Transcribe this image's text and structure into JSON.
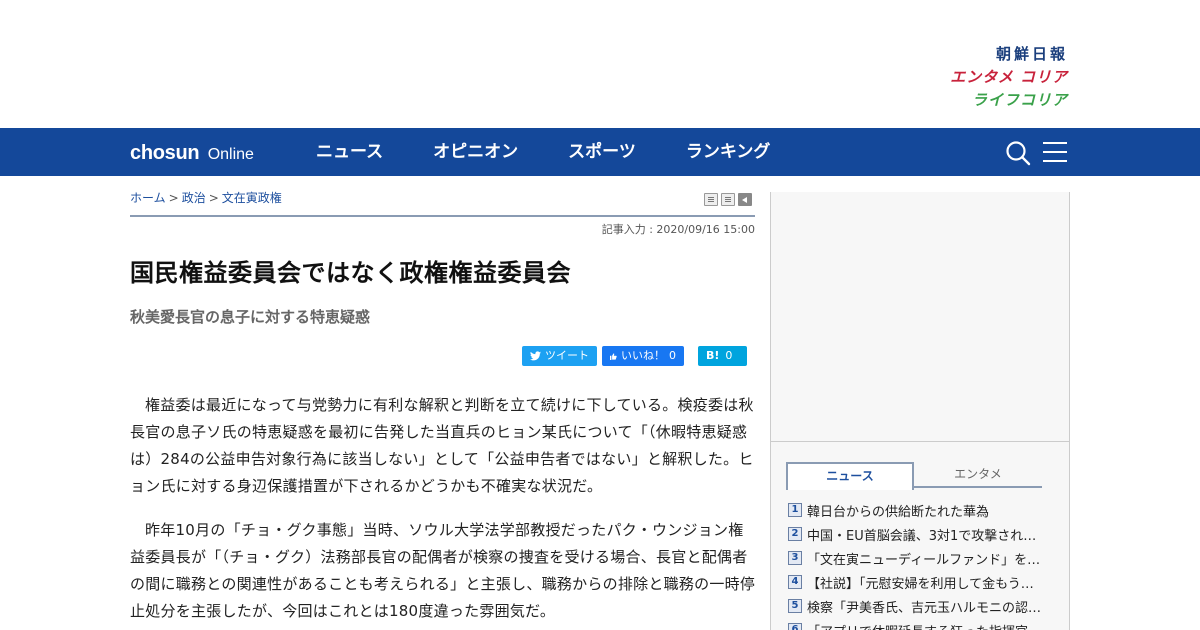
{
  "brands": {
    "chosun": "朝鮮日報",
    "entame": "エンタメ コリア",
    "life": "ライフコリア"
  },
  "nav": {
    "logo_main": "chosun",
    "logo_sub": "Online",
    "items": [
      "ニュース",
      "オピニオン",
      "スポーツ",
      "ランキング"
    ]
  },
  "breadcrumb": {
    "home": "ホーム",
    "sep": ">",
    "category": "政治",
    "subcategory": "文在寅政権"
  },
  "article": {
    "dateline": "記事入力 : 2020/09/16 15:00",
    "headline": "国民権益委員会ではなく政権権益委員会",
    "subhead": "秋美愛長官の息子に対する特恵疑惑",
    "paragraphs": [
      "権益委は最近になって与党勢力に有利な解釈と判断を立て続けに下している。検疫委は秋長官の息子ソ氏の特恵疑惑を最初に告発した当直兵のヒョン某氏について「（休暇特恵疑惑は）284の公益申告対象行為に該当しない」として「公益申告者ではない」と解釈した。ヒョン氏に対する身辺保護措置が下されるかどうかも不確実な状況だ。",
      "昨年10月の「チョ・グク事態」当時、ソウル大学法学部教授だったパク・ウンジョン権益委員長が「（チョ・グク）法務部長官の配偶者が検察の捜査を受ける場合、長官と配偶者の間に職務との関連性があることも考えられる」と主張し、職務からの排除と職務の一時停止処分を主張したが、今回はこれとは180度違った雰囲気だ。"
    ]
  },
  "share": {
    "tweet": "ツイート",
    "like": "いいね！",
    "like_count": "0",
    "hatena": "B!",
    "hatena_count": "0"
  },
  "sidebar": {
    "tabs": [
      "ニュース",
      "エンタメ"
    ],
    "active_tab": "ニュース",
    "ranking": [
      {
        "num": "1",
        "title": "韓日台からの供給断たれた華為"
      },
      {
        "num": "2",
        "title": "中国・EU首脳会議、3対1で攻撃され…"
      },
      {
        "num": "3",
        "title": "「文在寅ニューディールファンド」を…"
      },
      {
        "num": "4",
        "title": "【社説】「元慰安婦を利用して金もう…"
      },
      {
        "num": "5",
        "title": "検察「尹美香氏、吉元玉ハルモニの認…"
      },
      {
        "num": "6",
        "title": "「アプリで休暇延長する狂った指揮官…"
      }
    ]
  },
  "colors": {
    "nav_bg": "#14489a",
    "link": "#1d4f9e",
    "twitter": "#1da1f2",
    "facebook": "#1877f2",
    "hatena": "#00a4de"
  },
  "icons": {
    "search": "search-icon",
    "menu": "hamburger-menu-icon"
  }
}
